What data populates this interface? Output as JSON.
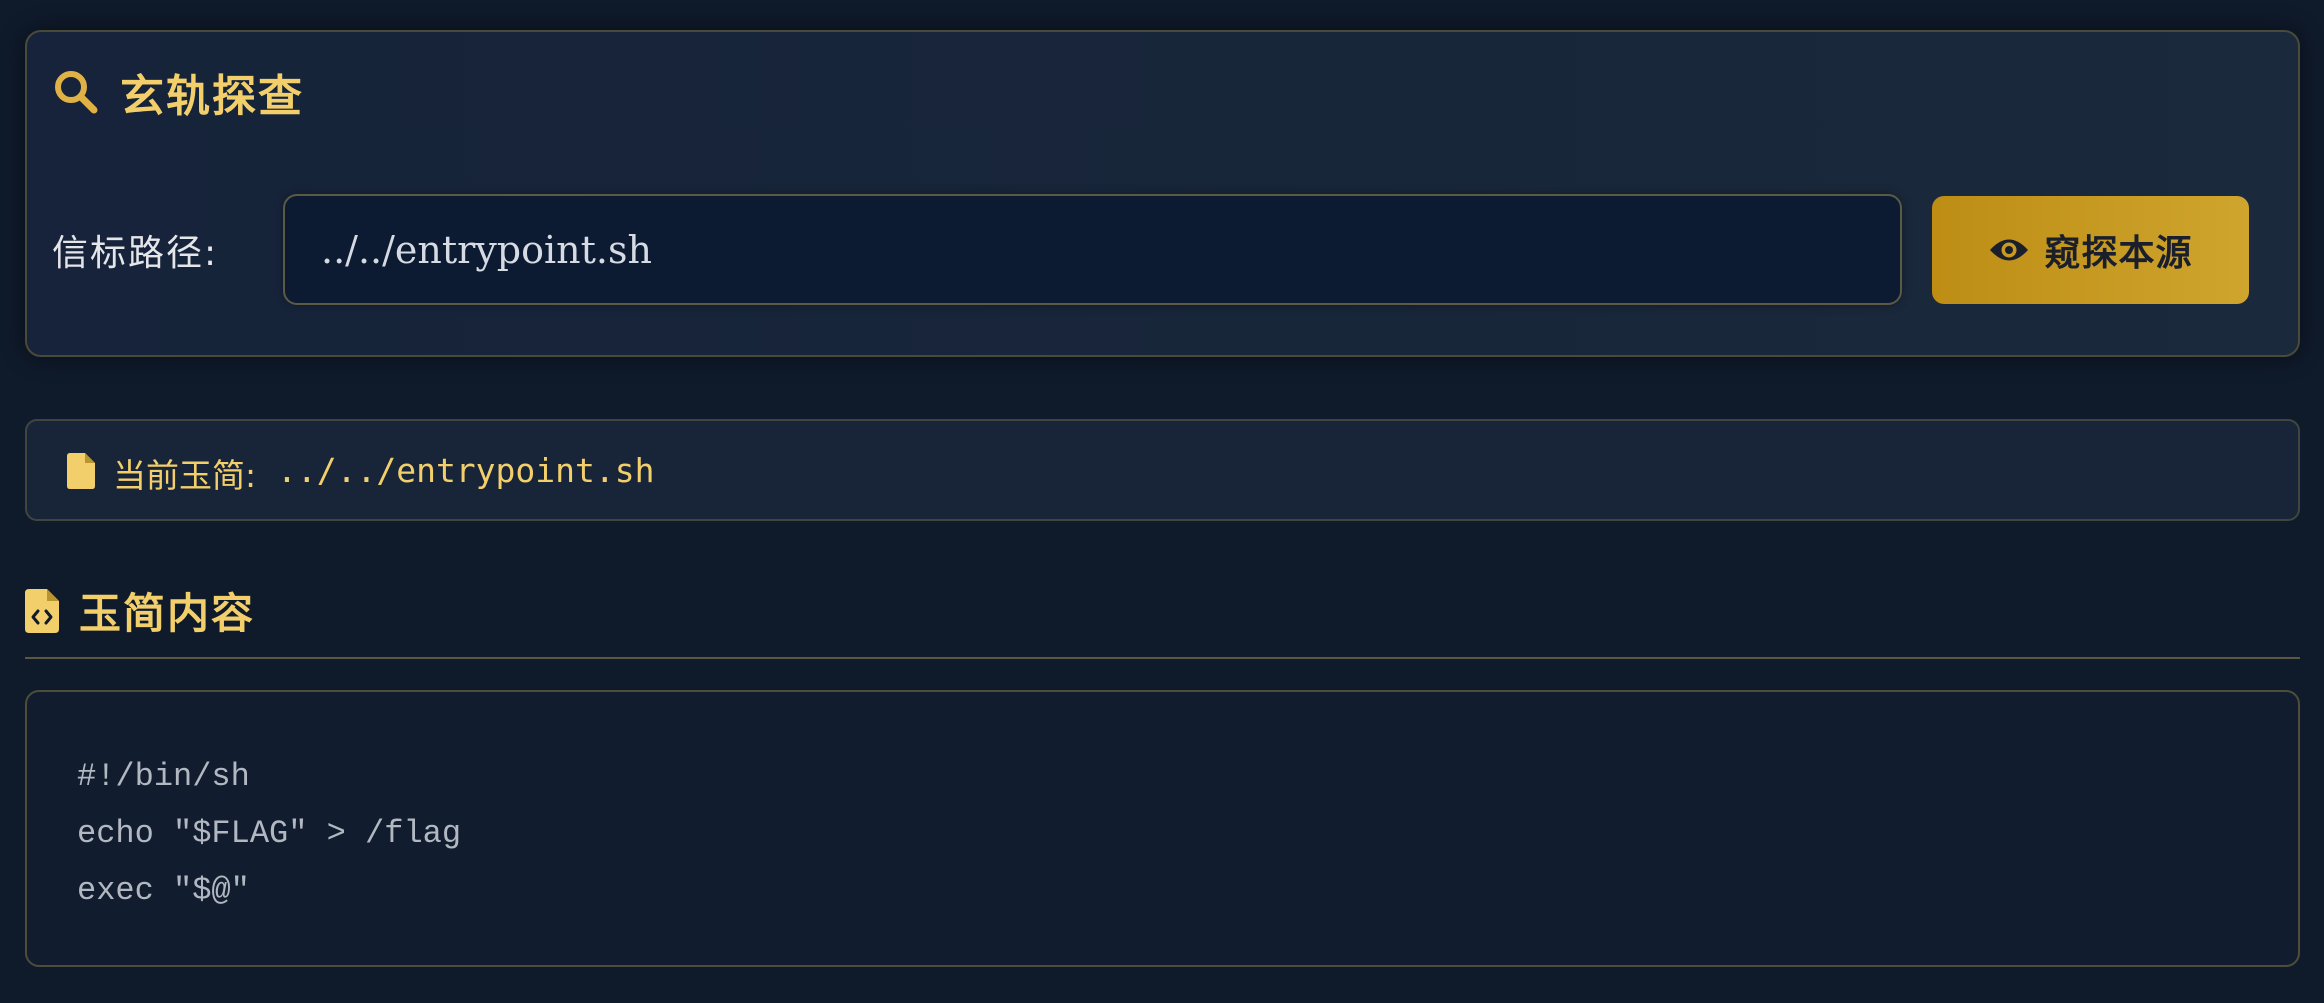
{
  "search_panel": {
    "title": "玄轨探查",
    "title_icon": "search-icon",
    "path_label": "信标路径:",
    "path_value": "../../entrypoint.sh",
    "probe_button_label": "窥探本源",
    "probe_button_icon": "eye-icon"
  },
  "current_file": {
    "icon": "file-icon",
    "label": "当前玉简:",
    "value": "../../entrypoint.sh"
  },
  "content_section": {
    "icon": "file-code-icon",
    "title": "玉简内容",
    "lines": [
      "#!/bin/sh",
      "echo \"$FLAG\" > /flag",
      "exec \"$@\""
    ]
  },
  "colors": {
    "background": "#0f1a2b",
    "accent_gold": "#f3cf6b",
    "button_gold": "#c99a22",
    "code_text": "#b2b8c2"
  }
}
